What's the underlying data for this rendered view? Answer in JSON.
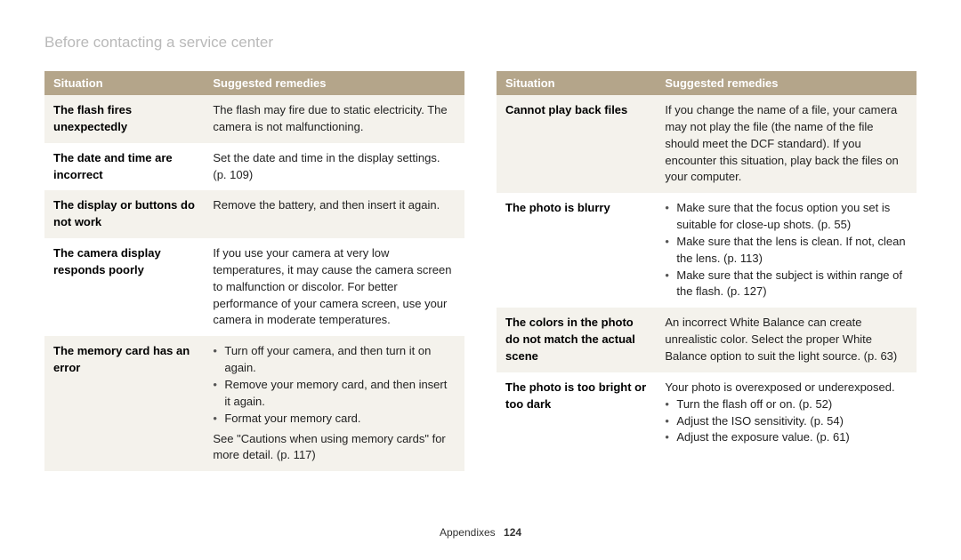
{
  "title": "Before contacting a service center",
  "headers": {
    "situation": "Situation",
    "remedy": "Suggested remedies"
  },
  "left": [
    {
      "situation": "The flash fires unexpectedly",
      "remedy": {
        "type": "text",
        "text": "The flash may fire due to static electricity. The camera is not malfunctioning."
      }
    },
    {
      "situation": "The date and time are incorrect",
      "remedy": {
        "type": "text",
        "text": "Set the date and time in the display settings. (p. 109)"
      }
    },
    {
      "situation": "The display or buttons do not work",
      "remedy": {
        "type": "text",
        "text": "Remove the battery, and then insert it again."
      }
    },
    {
      "situation": "The camera display responds poorly",
      "remedy": {
        "type": "text",
        "text": "If you use your camera at very low temperatures, it may cause the camera screen to malfunction or discolor. For better performance of your camera screen, use your camera in moderate temperatures."
      }
    },
    {
      "situation": "The memory card has an error",
      "remedy": {
        "type": "mixed",
        "bullets": [
          "Turn off your camera, and then turn it on again.",
          "Remove your memory card, and then insert it again.",
          "Format your memory card."
        ],
        "after": "See \"Cautions when using memory cards\" for more detail. (p. 117)"
      }
    }
  ],
  "right": [
    {
      "situation": "Cannot play back files",
      "remedy": {
        "type": "text",
        "text": "If you change the name of a file, your camera may not play the file (the name of the file should meet the DCF standard). If you encounter this situation, play back the files on your computer."
      }
    },
    {
      "situation": "The photo is blurry",
      "remedy": {
        "type": "bullets",
        "bullets": [
          "Make sure that the focus option you set is suitable for close-up shots. (p. 55)",
          "Make sure that the lens is clean. If not, clean the lens. (p. 113)",
          "Make sure that the subject is within range of the flash. (p. 127)"
        ]
      }
    },
    {
      "situation": "The colors in the photo do not match the actual scene",
      "remedy": {
        "type": "text",
        "text": "An incorrect White Balance can create unrealistic color. Select the proper White Balance option to suit the light source. (p. 63)"
      }
    },
    {
      "situation": "The photo is too bright or too dark",
      "remedy": {
        "type": "mixed2",
        "before": "Your photo is overexposed or underexposed.",
        "bullets": [
          "Turn the flash off or on. (p. 52)",
          "Adjust the ISO sensitivity. (p. 54)",
          "Adjust the exposure value. (p. 61)"
        ]
      }
    }
  ],
  "footer": {
    "section": "Appendixes",
    "page": "124"
  }
}
